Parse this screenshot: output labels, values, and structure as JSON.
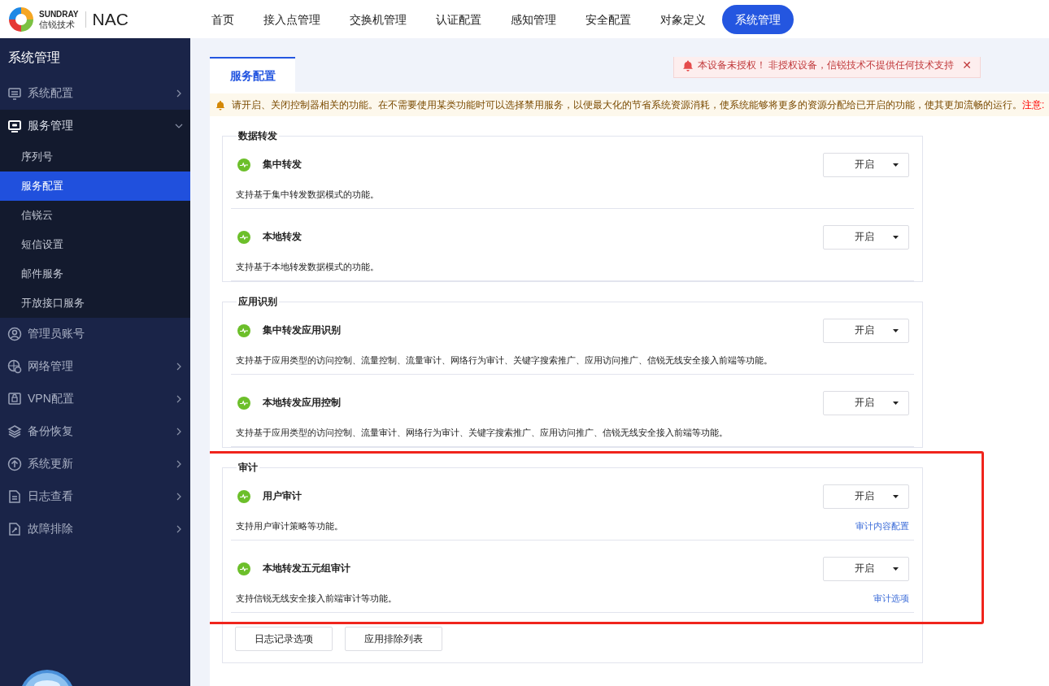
{
  "brand": {
    "name": "SUNDRAY",
    "name_cn": "信锐技术",
    "product": "NAC"
  },
  "nav": [
    {
      "label": "首页",
      "selected": false
    },
    {
      "label": "接入点管理",
      "selected": false
    },
    {
      "label": "交换机管理",
      "selected": false
    },
    {
      "label": "认证配置",
      "selected": false
    },
    {
      "label": "感知管理",
      "selected": false
    },
    {
      "label": "安全配置",
      "selected": false
    },
    {
      "label": "对象定义",
      "selected": false
    },
    {
      "label": "系统管理",
      "selected": true
    }
  ],
  "sidebar": {
    "title": "系统管理",
    "items": [
      {
        "label": "系统配置",
        "expanded": false,
        "has_children": true
      },
      {
        "label": "服务管理",
        "expanded": true,
        "has_children": true,
        "children": [
          {
            "label": "序列号",
            "selected": false
          },
          {
            "label": "服务配置",
            "selected": true
          },
          {
            "label": "信锐云",
            "selected": false
          },
          {
            "label": "短信设置",
            "selected": false
          },
          {
            "label": "邮件服务",
            "selected": false
          },
          {
            "label": "开放接口服务",
            "selected": false
          }
        ]
      },
      {
        "label": "管理员账号",
        "expanded": false,
        "has_children": false
      },
      {
        "label": "网络管理",
        "expanded": false,
        "has_children": true
      },
      {
        "label": "VPN配置",
        "expanded": false,
        "has_children": true
      },
      {
        "label": "备份恢复",
        "expanded": false,
        "has_children": true
      },
      {
        "label": "系统更新",
        "expanded": false,
        "has_children": true
      },
      {
        "label": "日志查看",
        "expanded": false,
        "has_children": true
      },
      {
        "label": "故障排除",
        "expanded": false,
        "has_children": true
      }
    ]
  },
  "tabs": [
    {
      "label": "服务配置",
      "selected": true
    }
  ],
  "alert": {
    "text": "本设备未授权！ 非授权设备，信锐技术不提供任何技术支持",
    "close": "✕"
  },
  "notice": {
    "text": "请开启、关闭控制器相关的功能。在不需要使用某类功能时可以选择禁用服务，以便最大化的节省系统资源消耗，使系统能够将更多的资源分配给已开启的功能，使其更加流畅的运行。",
    "warning": "注意:"
  },
  "sections": [
    {
      "title": "数据转发",
      "highlighted": false,
      "rows": [
        {
          "name": "集中转发",
          "status": "开启",
          "description": "支持基于集中转发数据模式的功能。"
        },
        {
          "name": "本地转发",
          "status": "开启",
          "description": "支持基于本地转发数据模式的功能。"
        }
      ]
    },
    {
      "title": "应用识别",
      "highlighted": false,
      "rows": [
        {
          "name": "集中转发应用识别",
          "status": "开启",
          "description": "支持基于应用类型的访问控制、流量控制、流量审计、网络行为审计、关键字搜索推广、应用访问推广、信锐无线安全接入前端等功能。"
        },
        {
          "name": "本地转发应用控制",
          "status": "开启",
          "description": "支持基于应用类型的访问控制、流量审计、网络行为审计、关键字搜索推广、应用访问推广、信锐无线安全接入前端等功能。"
        }
      ]
    },
    {
      "title": "审计",
      "highlighted": true,
      "rows": [
        {
          "name": "用户审计",
          "status": "开启",
          "description": "支持用户审计策略等功能。",
          "link": "审计内容配置"
        },
        {
          "name": "本地转发五元组审计",
          "status": "开启",
          "description": "支持信锐无线安全接入前端审计等功能。",
          "link": "审计选项"
        }
      ],
      "buttons": [
        "日志记录选项",
        "应用排除列表"
      ]
    }
  ]
}
